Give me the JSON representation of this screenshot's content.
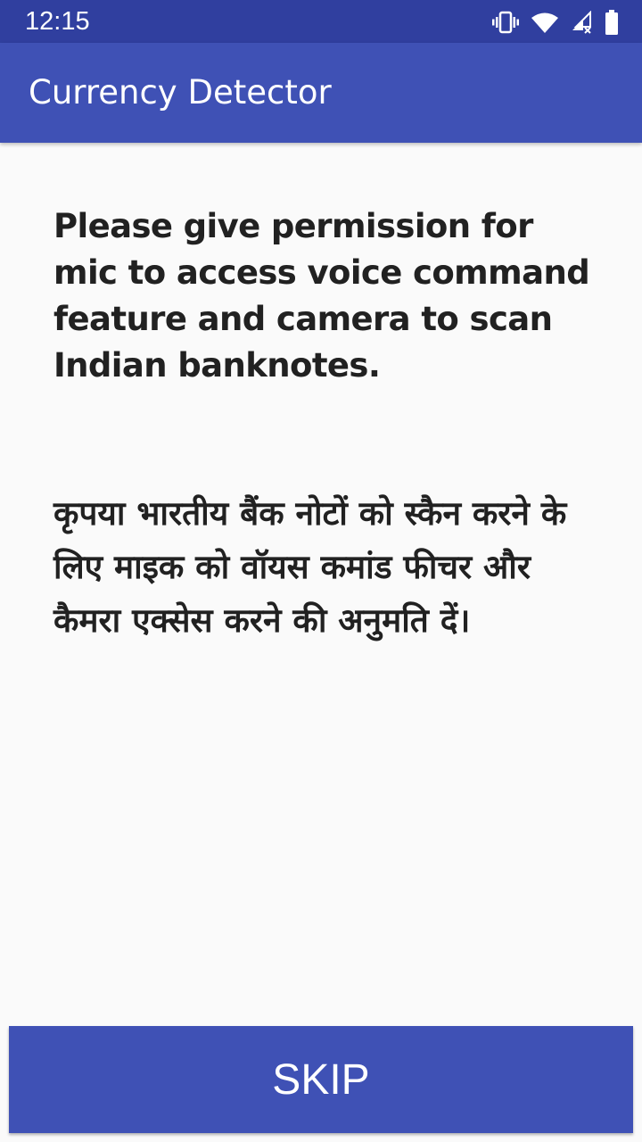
{
  "status_bar": {
    "time": "12:15",
    "icons": [
      "vibrate-icon",
      "wifi-icon",
      "cellular-signal-icon",
      "battery-icon"
    ]
  },
  "app_bar": {
    "title": "Currency Detector"
  },
  "permission_message": {
    "english": "Please give permission for mic to access voice command feature and camera to scan Indian banknotes.",
    "hindi": "कृपया भारतीय बैंक नोटों को स्कैन करने के लिए माइक को वॉयस कमांड फीचर और कैमरा एक्सेस करने की अनुमति दें।"
  },
  "skip_button": {
    "label": "SKIP"
  },
  "colors": {
    "status_bar": "#303f9f",
    "primary": "#3f51b5",
    "background": "#fafafa",
    "text": "#212121"
  }
}
